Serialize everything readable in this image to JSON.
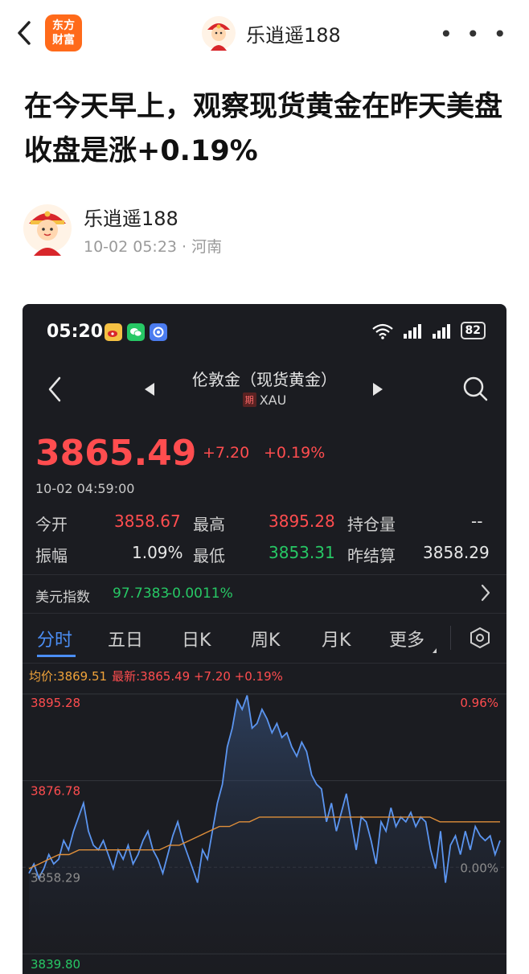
{
  "header": {
    "back_icon": "chevron-left-icon",
    "logo_line1": "东方",
    "logo_line2": "财富",
    "author_name": "乐逍遥188",
    "more_icon": "more-dots-icon",
    "more_label": "• • •"
  },
  "article": {
    "title": "在今天早上，观察现货黄金在昨天美盘收盘是涨+0.19%",
    "author_name": "乐逍遥188",
    "meta": "10-02 05:23 · 河南"
  },
  "screenshot": {
    "status": {
      "time": "05:20",
      "battery": "82",
      "apps": [
        "weibo-icon",
        "wechat-icon",
        "browser-icon"
      ]
    },
    "nav": {
      "instrument_name": "伦敦金（现货黄金）",
      "tag": "期",
      "code": "XAU"
    },
    "quote": {
      "price": "3865.49",
      "change": "+7.20",
      "change_pct": "+0.19%",
      "time": "10-02 04:59:00"
    },
    "stats": {
      "open_label": "今开",
      "open_value": "3858.67",
      "high_label": "最高",
      "high_value": "3895.28",
      "oi_label": "持仓量",
      "oi_value": "--",
      "amp_label": "振幅",
      "amp_value": "1.09%",
      "low_label": "最低",
      "low_value": "3853.31",
      "settle_label": "昨结算",
      "settle_value": "3858.29"
    },
    "usd_index": {
      "label": "美元指数",
      "value": "97.7383",
      "change": "-0.0011%"
    },
    "tabs": [
      "分时",
      "五日",
      "日K",
      "周K",
      "月K",
      "更多"
    ],
    "avg_info": {
      "avg": "均价:3869.51",
      "last": "最新:3865.49  +7.20  +0.19%"
    },
    "colors": {
      "up": "#ff4d4f",
      "down": "#27c865",
      "accent": "#4b8ef5",
      "avg_line": "#f0a33a",
      "background": "#1b1c21"
    }
  },
  "chart_data": {
    "type": "line",
    "title": "",
    "y_tick_labels": [
      "3895.28",
      "3876.78",
      "3858.29",
      "3839.80"
    ],
    "y_ticks": [
      3895.28,
      3876.78,
      3858.29,
      3839.8
    ],
    "right_labels": [
      "0.96%",
      "0.00%"
    ],
    "ylim": [
      3835.5,
      3897.5
    ],
    "series": [
      {
        "values": [
          3857,
          3859,
          3856,
          3858,
          3861,
          3859,
          3860,
          3864,
          3862,
          3866,
          3869,
          3872,
          3866,
          3863,
          3862,
          3864,
          3861,
          3858,
          3862,
          3860,
          3863,
          3859,
          3861,
          3864,
          3866,
          3862,
          3860,
          3857,
          3861,
          3865,
          3868,
          3864,
          3861,
          3858,
          3855,
          3862,
          3860,
          3866,
          3872,
          3876,
          3884,
          3888,
          3894,
          3892,
          3895,
          3888,
          3889,
          3892,
          3890,
          3887,
          3889,
          3886,
          3887,
          3884,
          3882,
          3885,
          3883,
          3878,
          3876,
          3875,
          3868,
          3872,
          3866,
          3870,
          3874,
          3868,
          3862,
          3869,
          3868,
          3864,
          3859,
          3868,
          3866,
          3871,
          3867,
          3869,
          3868,
          3870,
          3867,
          3869,
          3868,
          3862,
          3858,
          3866,
          3855,
          3863,
          3865,
          3861,
          3866,
          3862,
          3867,
          3865,
          3864,
          3865,
          3861,
          3864
        ]
      },
      {
        "values": [
          3858,
          3859,
          3860,
          3861,
          3861,
          3862,
          3862,
          3862,
          3862,
          3862,
          3862,
          3862,
          3862,
          3862,
          3863,
          3863,
          3864,
          3865,
          3866,
          3867,
          3867,
          3868,
          3868,
          3869,
          3869,
          3869,
          3869,
          3869,
          3869,
          3869,
          3869,
          3869,
          3869,
          3869,
          3869,
          3869,
          3869,
          3869,
          3869,
          3869,
          3869,
          3868,
          3868,
          3868,
          3868,
          3868,
          3868,
          3868
        ]
      }
    ],
    "grid": true
  }
}
